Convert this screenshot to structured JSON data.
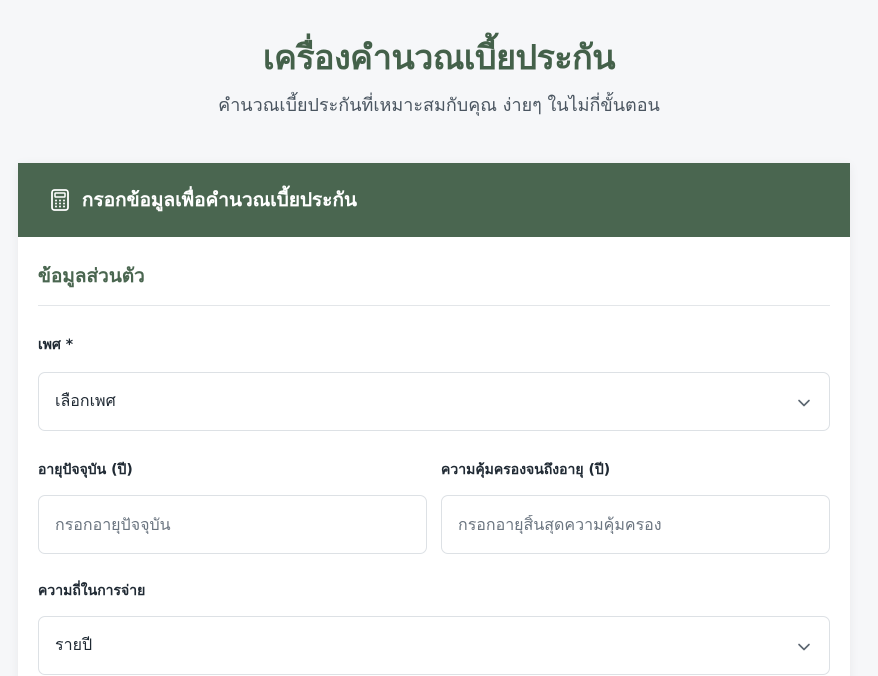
{
  "header": {
    "title": "เครื่องคำนวณเบี้ยประกัน",
    "subtitle": "คำนวณเบี้ยประกันที่เหมาะสมกับคุณ ง่ายๆ ในไม่กี่ขั้นตอน"
  },
  "card": {
    "header_title": "กรอกข้อมูลเพื่อคำนวณเบี้ยประกัน",
    "header_icon": "calculator-icon",
    "section_title": "ข้อมูลส่วนตัว",
    "gender": {
      "label": "เพศ *",
      "value": "เลือกเพศ"
    },
    "current_age": {
      "label": "อายุปัจจุบัน (ปี)",
      "placeholder": "กรอกอายุปัจจุบัน"
    },
    "coverage_age": {
      "label": "ความคุ้มครองจนถึงอายุ (ปี)",
      "placeholder": "กรอกอายุสิ้นสุดความคุ้มครอง"
    },
    "payment_frequency": {
      "label": "ความถี่ในการจ่าย",
      "value": "รายปี"
    }
  },
  "colors": {
    "brand_green": "#4a6650",
    "title_green": "#44614a",
    "background": "#f6f7f9"
  }
}
